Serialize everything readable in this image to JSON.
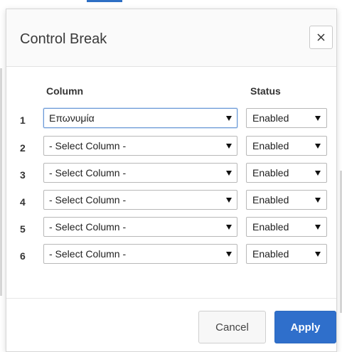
{
  "dialog": {
    "title": "Control Break",
    "close_glyph": "×"
  },
  "columns_header": "Column",
  "status_header": "Status",
  "rows": [
    {
      "num": "1",
      "column": "Επωνυμία",
      "status": "Enabled"
    },
    {
      "num": "2",
      "column": "- Select Column -",
      "status": "Enabled"
    },
    {
      "num": "3",
      "column": "- Select Column -",
      "status": "Enabled"
    },
    {
      "num": "4",
      "column": "- Select Column -",
      "status": "Enabled"
    },
    {
      "num": "5",
      "column": "- Select Column -",
      "status": "Enabled"
    },
    {
      "num": "6",
      "column": "- Select Column -",
      "status": "Enabled"
    }
  ],
  "buttons": {
    "cancel": "Cancel",
    "apply": "Apply"
  },
  "colors": {
    "primary": "#2f6fcb",
    "border": "#b8b8b8",
    "focus": "#6d9ad6"
  },
  "icons": {
    "close": "close-icon",
    "dropdown": "chevron-down-icon"
  }
}
